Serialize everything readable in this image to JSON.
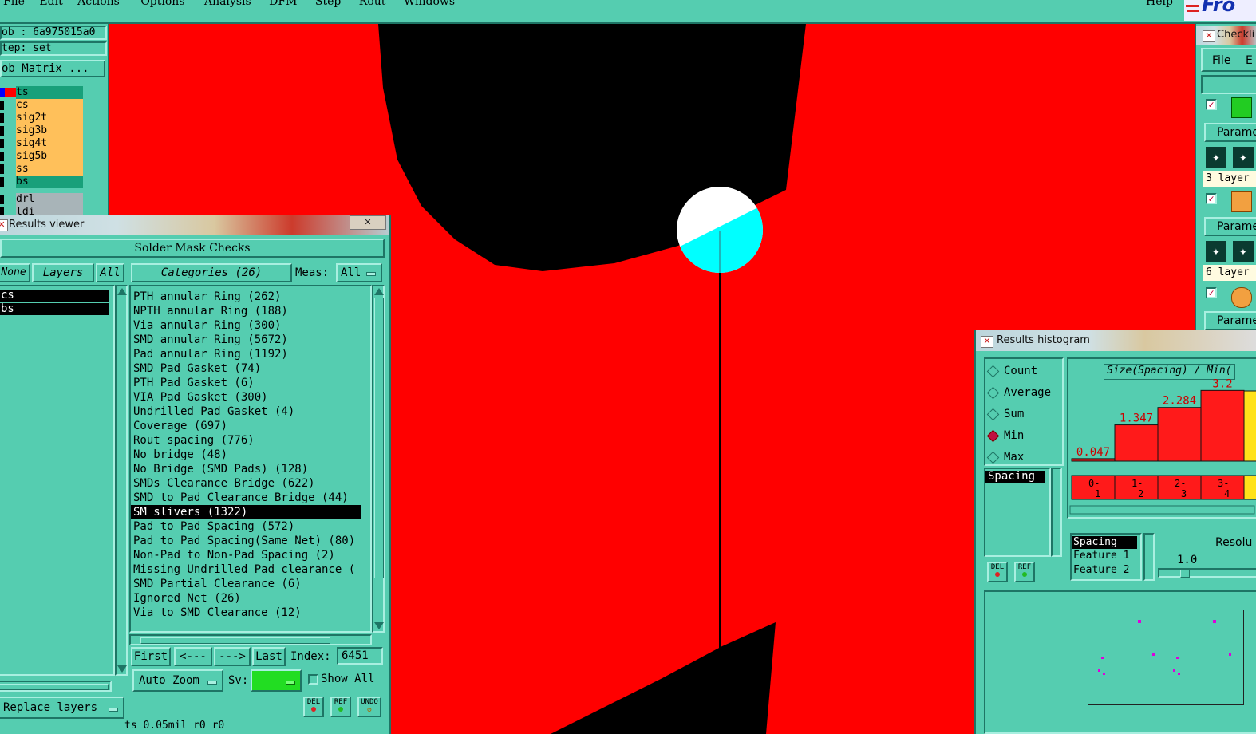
{
  "menubar": {
    "items": [
      "File",
      "Edit",
      "Actions",
      "Options",
      "Analysis",
      "DFM",
      "Step",
      "Rout",
      "Windows"
    ],
    "help": "Help",
    "logo": "Fro"
  },
  "job_panel": {
    "job": "ob : 6a975015a0",
    "step": "tep: set",
    "matrix_button": "ob Matrix ...",
    "layers": [
      {
        "name": "ts",
        "color": "#18a07a"
      },
      {
        "name": "cs",
        "color": "#ffc05a"
      },
      {
        "name": "sig2t",
        "color": "#ffc05a"
      },
      {
        "name": "sig3b",
        "color": "#ffc05a"
      },
      {
        "name": "sig4t",
        "color": "#ffc05a"
      },
      {
        "name": "sig5b",
        "color": "#ffc05a"
      },
      {
        "name": "ss",
        "color": "#ffc05a"
      },
      {
        "name": "bs",
        "color": "#18a07a"
      },
      {
        "name": "drl",
        "color": "#a8b4b8"
      },
      {
        "name": "ldi",
        "color": "#a8b4b8"
      }
    ]
  },
  "results_viewer": {
    "title": "Results viewer",
    "header": "Solder Mask Checks",
    "none_btn": "None",
    "layers_btn": "Layers",
    "all_btn": "All",
    "categories_btn": "Categories (26)",
    "meas_label": "Meas:",
    "meas_value": "All",
    "layer_list": [
      "cs",
      "bs"
    ],
    "categories": [
      "PTH annular Ring (262)",
      "NPTH annular Ring (188)",
      "Via annular Ring (300)",
      "SMD annular Ring (5672)",
      "Pad annular Ring (1192)",
      "SMD Pad Gasket (74)",
      "PTH Pad Gasket (6)",
      "VIA Pad Gasket (300)",
      "Undrilled Pad Gasket (4)",
      "Coverage (697)",
      "Rout spacing (776)",
      "No bridge (48)",
      "No Bridge (SMD Pads) (128)",
      "SMDs Clearance Bridge (622)",
      "SMD to Pad Clearance Bridge (44)",
      "SM slivers (1322)",
      "Pad to Pad Spacing (572)",
      "Pad to Pad Spacing(Same Net) (80)",
      "Non-Pad to Non-Pad Spacing (2)",
      "Missing Undrilled Pad clearance (",
      "SMD Partial Clearance (6)",
      "Ignored Net (26)",
      "Via to SMD Clearance (12)"
    ],
    "selected_category": 15,
    "first_btn": "First",
    "prev_btn": "<---",
    "next_btn": "--->",
    "last_btn": "Last",
    "index_label": "Index:",
    "index_value": "6451",
    "zoom_value": "Auto Zoom",
    "sv_label": "Sv:",
    "show_all": "Show All",
    "replace_layers": "Replace layers",
    "del": "DEL",
    "ref": "REF",
    "undo": "UNDO",
    "status": "ts 0.05mil  r0  r0"
  },
  "checklist": {
    "title": "Checkli",
    "menu_file": "File",
    "menu_e": "E",
    "param1": "Parame",
    "layers1": "3 layer",
    "param2": "Parame",
    "layers2": "6 layer",
    "param3": "Parame"
  },
  "histogram": {
    "title": "Results histogram",
    "options": [
      "Count",
      "Average",
      "Sum",
      "Min",
      "Max"
    ],
    "selected_option": "Min",
    "left_list": [
      "Spacing"
    ],
    "chart_title": "Size(Spacing) / Min(",
    "bar_labels": [
      "0.047",
      "1.347",
      "2.284",
      "3.2"
    ],
    "bins": [
      "0-1",
      "1-2",
      "2-3",
      "3-4"
    ],
    "feature_list": [
      "Spacing",
      "Feature 1",
      "Feature 2"
    ],
    "resolution_label": "Resolu",
    "resolution_value": "1.0",
    "del": "DEL",
    "ref": "REF",
    "chart_data": {
      "type": "bar",
      "categories": [
        "0-1",
        "1-2",
        "2-3",
        "3-4"
      ],
      "values": [
        0.047,
        1.347,
        2.284,
        3.2
      ],
      "title": "Size(Spacing) / Min(",
      "xlabel": "",
      "ylabel": ""
    }
  },
  "colors": {
    "background": "#ff0000",
    "panel": "#55cdb0",
    "pad": "#000000",
    "highlight": "#00ffff"
  }
}
